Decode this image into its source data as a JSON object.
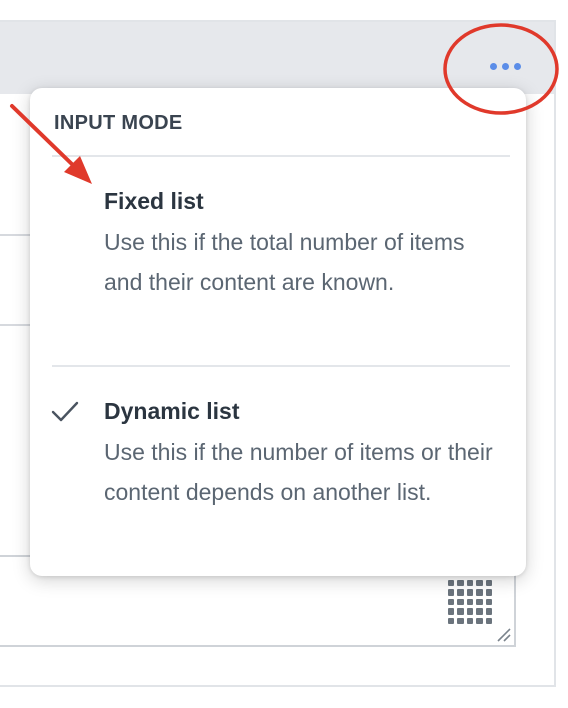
{
  "menu": {
    "heading": "INPUT MODE",
    "items": [
      {
        "title": "Fixed list",
        "description": "Use this if the total number of items and their content are known.",
        "selected": false
      },
      {
        "title": "Dynamic list",
        "description": "Use this if the number of items or their content depends on another list.",
        "selected": true
      }
    ]
  },
  "icons": {
    "more": "more-horizontal-icon",
    "check": "checkmark-icon",
    "grid": "grid-dots-icon",
    "resize": "resize-handle-icon"
  },
  "colors": {
    "accent": "#5b8de8",
    "annotation": "#e0392b",
    "menu_bg": "#ffffff",
    "header_bg": "#e6e8ec"
  }
}
